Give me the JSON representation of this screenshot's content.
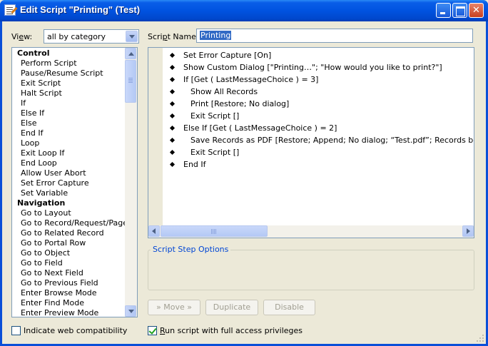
{
  "window": {
    "title": "Edit Script \"Printing\" (Test)"
  },
  "view": {
    "label_pre": "Vi",
    "label_ul": "e",
    "label_post": "w:",
    "selected": "all by category"
  },
  "script_name": {
    "label_pre": "Scri",
    "label_ul": "p",
    "label_post": "t Name:",
    "value": "Printing"
  },
  "step_list": [
    {
      "label": "Control",
      "category": true
    },
    {
      "label": "Perform Script"
    },
    {
      "label": "Pause/Resume Script"
    },
    {
      "label": "Exit Script"
    },
    {
      "label": "Halt Script"
    },
    {
      "label": "If"
    },
    {
      "label": "Else If"
    },
    {
      "label": "Else"
    },
    {
      "label": "End If"
    },
    {
      "label": "Loop"
    },
    {
      "label": "Exit Loop If"
    },
    {
      "label": "End Loop"
    },
    {
      "label": "Allow User Abort"
    },
    {
      "label": "Set Error Capture"
    },
    {
      "label": "Set Variable"
    },
    {
      "label": "Navigation",
      "category": true
    },
    {
      "label": "Go to Layout"
    },
    {
      "label": "Go to Record/Request/Page"
    },
    {
      "label": "Go to Related Record"
    },
    {
      "label": "Go to Portal Row"
    },
    {
      "label": "Go to Object"
    },
    {
      "label": "Go to Field"
    },
    {
      "label": "Go to Next Field"
    },
    {
      "label": "Go to Previous Field"
    },
    {
      "label": "Enter Browse Mode"
    },
    {
      "label": "Enter Find Mode"
    },
    {
      "label": "Enter Preview Mode"
    }
  ],
  "script_steps": [
    {
      "text": "Set Error Capture [On]",
      "indent": 0
    },
    {
      "text": "Show Custom Dialog [\"Printing…\"; \"How would you like to print?\"]",
      "indent": 0
    },
    {
      "text": "If [Get ( LastMessageChoice ) = 3]",
      "indent": 0
    },
    {
      "text": "Show All Records",
      "indent": 1
    },
    {
      "text": "Print [Restore; No dialog]",
      "indent": 1
    },
    {
      "text": "Exit Script []",
      "indent": 1
    },
    {
      "text": "Else If [Get ( LastMessageChoice ) = 2]",
      "indent": 0
    },
    {
      "text": "Save Records as PDF [Restore; Append; No dialog; “Test.pdf”; Records being brows",
      "indent": 1
    },
    {
      "text": "Exit Script []",
      "indent": 1
    },
    {
      "text": "End If",
      "indent": 0
    }
  ],
  "options": {
    "title": "Script Step Options"
  },
  "buttons": {
    "move": "» Move »",
    "duplicate": "Duplicate",
    "disable": "Disable"
  },
  "checks": {
    "web_compat": "Indicate web compatibility",
    "web_compat_checked": false,
    "full_access_ul": "R",
    "full_access_rest": "un script with full access privileges",
    "full_access_checked": true
  },
  "colors": {
    "titlebar": "#0053e0",
    "selection": "#316ac5",
    "group_title": "#0046d5"
  }
}
